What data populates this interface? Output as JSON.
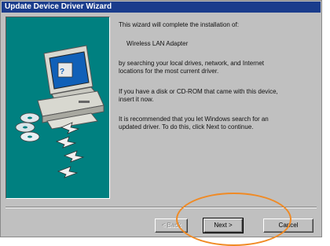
{
  "window": {
    "title": "Update Device Driver Wizard"
  },
  "content": {
    "intro": "This wizard will complete the installation of:",
    "device_name": "Wireless LAN Adapter",
    "search_line1": "by searching your local drives, network, and Internet",
    "search_line2": "locations for the most current driver.",
    "disk_line1": "If you have a disk or CD-ROM that came with this device,",
    "disk_line2": "insert it now.",
    "rec_line1": "It is recommended that you let Windows search for an",
    "rec_line2": "updated driver. To do this, click Next to continue."
  },
  "buttons": {
    "back": "< Back",
    "next": "Next >",
    "cancel": "Cancel"
  },
  "colors": {
    "title_bar": "#1a3c8c",
    "art_background": "#008080",
    "highlight_circle": "#f08a24"
  },
  "icons": [
    "computer-icon",
    "cd-disc-icon",
    "arrow-icon"
  ]
}
